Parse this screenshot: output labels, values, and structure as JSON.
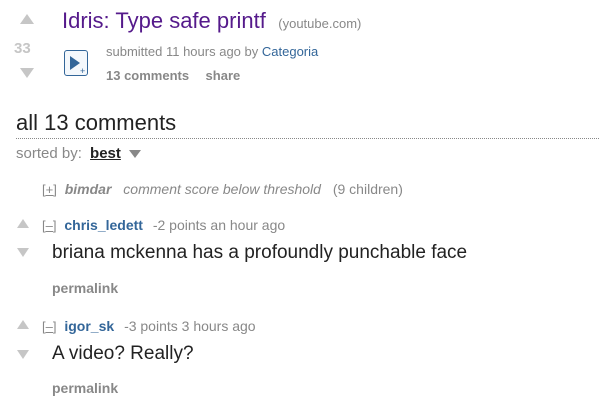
{
  "post": {
    "score": "33",
    "title": "Idris: Type safe printf",
    "domain": "(youtube.com)",
    "submitted_prefix": "submitted 11 hours ago by",
    "author": "Categoria",
    "comments_link": "13 comments",
    "share_link": "share"
  },
  "comments_area": {
    "heading": "all 13 comments",
    "sorted_by_label": "sorted by:",
    "sort_value": "best"
  },
  "collapsed_comment": {
    "expand": "[+]",
    "author": "bimdar",
    "note": "comment score below threshold",
    "children": "(9 children)"
  },
  "comments": [
    {
      "toggle": "[–]",
      "author": "chris_ledett",
      "meta": "-2 points an hour ago",
      "body": "briana mckenna has a profoundly punchable face",
      "permalink": "permalink"
    },
    {
      "toggle": "[–]",
      "author": "igor_sk",
      "meta": "-3 points 3 hours ago",
      "body": "A video? Really?",
      "permalink": "permalink"
    }
  ],
  "icons": {
    "vote_up": "up-arrow-icon",
    "vote_down": "down-arrow-icon",
    "thumbnail": "video-play-icon",
    "sort_dropdown": "triangle-down-icon"
  },
  "colors": {
    "title": "#551a8b",
    "author": "#336699",
    "muted": "#888888",
    "arrow": "#c6c6c6"
  }
}
